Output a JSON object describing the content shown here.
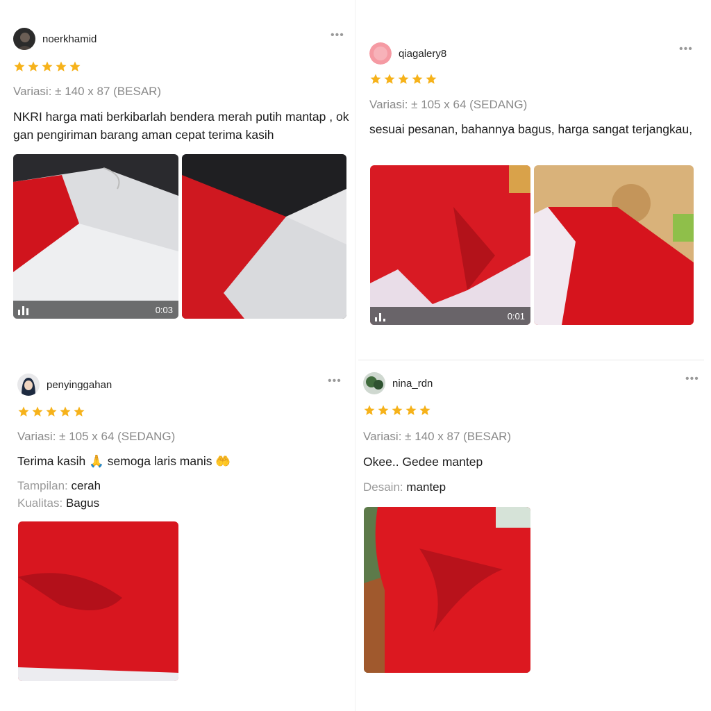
{
  "reviews": [
    {
      "username": "noerkhamid",
      "rating": 5,
      "variant": "Variasi: ± 140 x 87 (BESAR)",
      "text": "NKRI harga mati berkibarlah bendera merah putih mantap , ok gan pengiriman barang aman cepat terima kasih",
      "video_duration": "0:03",
      "more_icon": "more-dots-icon"
    },
    {
      "username": "qiagalery8",
      "rating": 5,
      "variant": "Variasi: ± 105 x 64 (SEDANG)",
      "text": "sesuai pesanan, bahannya bagus, harga sangat terjangkau,",
      "video_duration": "0:01",
      "more_icon": "more-dots-icon"
    },
    {
      "username": "penyinggahan",
      "rating": 5,
      "variant": "Variasi: ± 105 x 64 (SEDANG)",
      "text": "Terima kasih 🙏 semoga laris manis 🤲",
      "attributes": [
        {
          "key": "Tampilan:",
          "value": "cerah"
        },
        {
          "key": "Kualitas:",
          "value": "Bagus"
        }
      ],
      "more_icon": "more-dots-icon"
    },
    {
      "username": "nina_rdn",
      "rating": 5,
      "variant": "Variasi: ± 140 x 87 (BESAR)",
      "text": "Okee.. Gedee mantep",
      "attributes": [
        {
          "key": "Desain:",
          "value": "mantep"
        }
      ],
      "more_icon": "more-dots-icon"
    }
  ],
  "colors": {
    "star": "#f6b21a",
    "flag_red": "#e01b24",
    "flag_white": "#f2f2f4",
    "muted_text": "#8a8a8a"
  }
}
